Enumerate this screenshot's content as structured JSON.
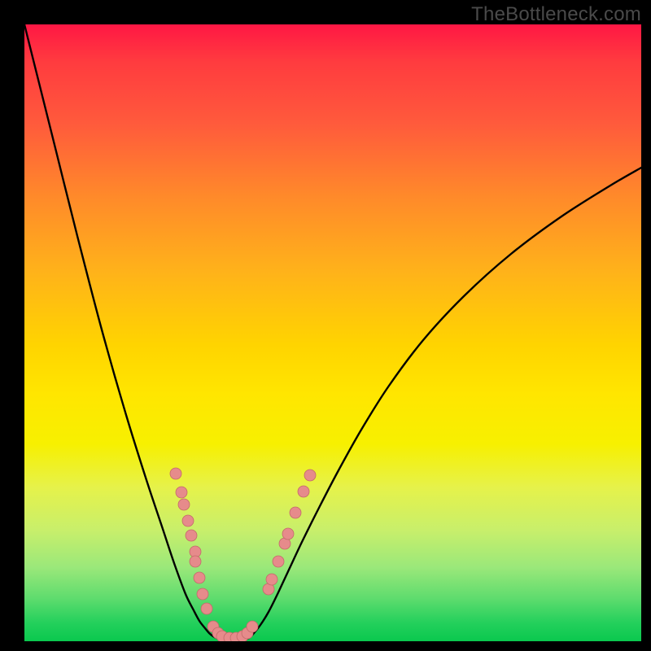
{
  "watermark": "TheBottleneck.com",
  "colors": {
    "frame": "#000000",
    "curve": "#000000",
    "marker_fill": "#e68b8b",
    "marker_stroke": "#c46a6a"
  },
  "chart_data": {
    "type": "line",
    "title": "",
    "xlabel": "",
    "ylabel": "",
    "xlim": [
      0,
      100
    ],
    "ylim": [
      0,
      100
    ],
    "grid": false,
    "legend": false,
    "note": "Plot-area pixel coordinates (758x758, origin top-left). No axes/ticks shown; values are visual positions.",
    "series": [
      {
        "name": "left-branch",
        "x": [
          0,
          15,
          40,
          65,
          95,
          125,
          150,
          170,
          185,
          198,
          208,
          215,
          222,
          227,
          232,
          236
        ],
        "y": [
          0,
          60,
          160,
          260,
          375,
          480,
          560,
          620,
          665,
          700,
          720,
          733,
          742,
          748,
          752,
          754
        ]
      },
      {
        "name": "valley-floor",
        "x": [
          236,
          244,
          252,
          260,
          268,
          276
        ],
        "y": [
          754,
          755,
          756,
          756,
          755,
          754
        ]
      },
      {
        "name": "right-branch",
        "x": [
          276,
          282,
          290,
          300,
          312,
          326,
          342,
          362,
          386,
          414,
          448,
          490,
          540,
          598,
          660,
          720,
          758
        ],
        "y": [
          754,
          748,
          738,
          722,
          698,
          668,
          634,
          594,
          548,
          498,
          444,
          388,
          334,
          282,
          236,
          198,
          176
        ]
      }
    ],
    "markers": {
      "name": "highlight-dots",
      "radius_px": 7,
      "points": [
        {
          "x": 186,
          "y": 552
        },
        {
          "x": 193,
          "y": 575
        },
        {
          "x": 196,
          "y": 590
        },
        {
          "x": 201,
          "y": 610
        },
        {
          "x": 205,
          "y": 628
        },
        {
          "x": 210,
          "y": 648
        },
        {
          "x": 210,
          "y": 660
        },
        {
          "x": 215,
          "y": 680
        },
        {
          "x": 219,
          "y": 700
        },
        {
          "x": 224,
          "y": 718
        },
        {
          "x": 232,
          "y": 740
        },
        {
          "x": 238,
          "y": 748
        },
        {
          "x": 243,
          "y": 752
        },
        {
          "x": 252,
          "y": 754
        },
        {
          "x": 260,
          "y": 754
        },
        {
          "x": 268,
          "y": 752
        },
        {
          "x": 274,
          "y": 748
        },
        {
          "x": 280,
          "y": 740
        },
        {
          "x": 300,
          "y": 694
        },
        {
          "x": 304,
          "y": 682
        },
        {
          "x": 312,
          "y": 660
        },
        {
          "x": 320,
          "y": 638
        },
        {
          "x": 324,
          "y": 626
        },
        {
          "x": 333,
          "y": 600
        },
        {
          "x": 343,
          "y": 574
        },
        {
          "x": 351,
          "y": 554
        }
      ]
    }
  }
}
